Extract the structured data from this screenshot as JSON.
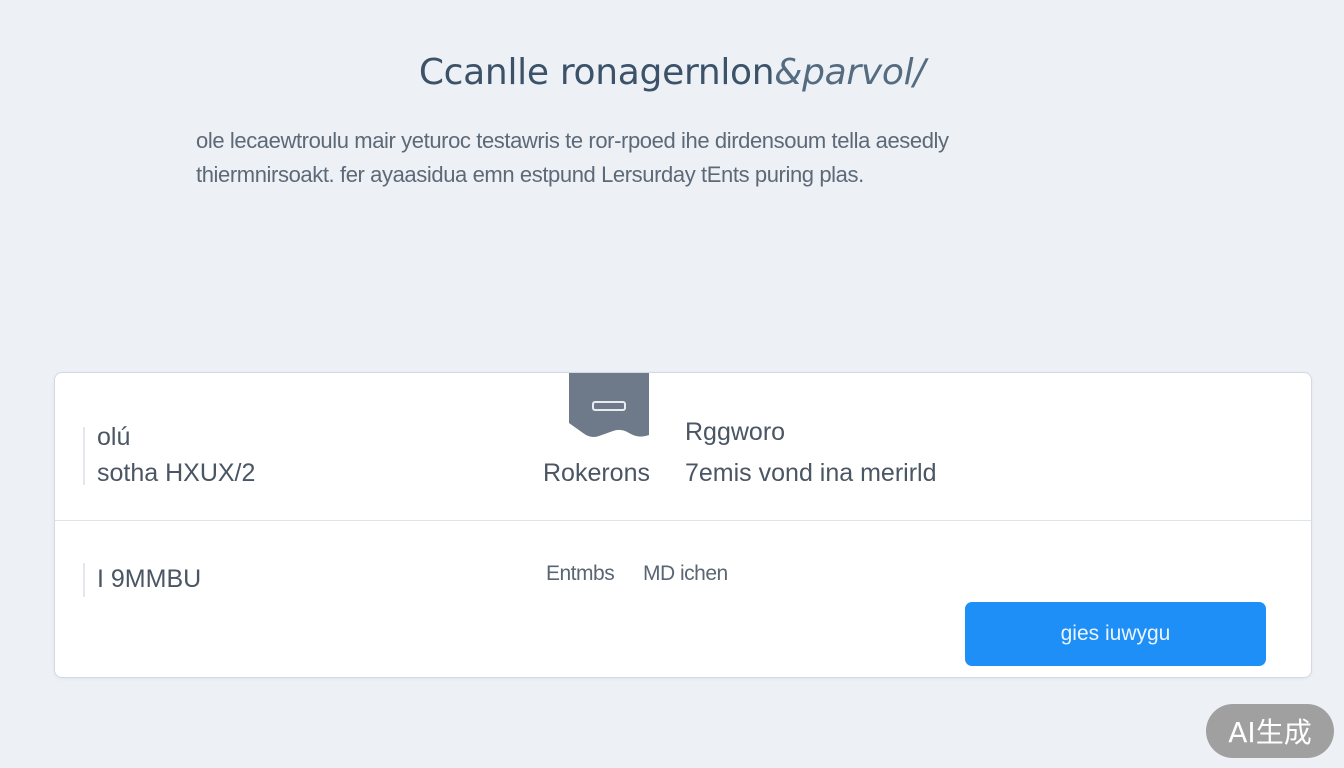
{
  "header": {
    "title": "Ccanlle ronagernlon",
    "title_accent": "&parvol/"
  },
  "intro": {
    "line1": "ole lecaewtroulu mair yeturoc testawris te ror-rpoed ihe dirdensoum tella aesedly",
    "line2": "thiermnirsoakt. fer ayaasidua emn estpund Lersurday tEnts puring plas."
  },
  "card": {
    "row1": {
      "label": "olú",
      "value": "sotha HXUX/2",
      "mid_label": "Rokerons",
      "right_title": "Rggworo",
      "right_value": "7emis vond ina merirld"
    },
    "row2": {
      "label": "I 9MMBU",
      "mid_label": "Entmbs",
      "mid_value": "MD ichen"
    },
    "button_label": "gies iuwygu"
  },
  "badge": {
    "label": "AI生成"
  },
  "colors": {
    "background": "#edf1f6",
    "card": "#ffffff",
    "accent": "#1e8ff7",
    "tab_marker": "#6e7a89"
  }
}
